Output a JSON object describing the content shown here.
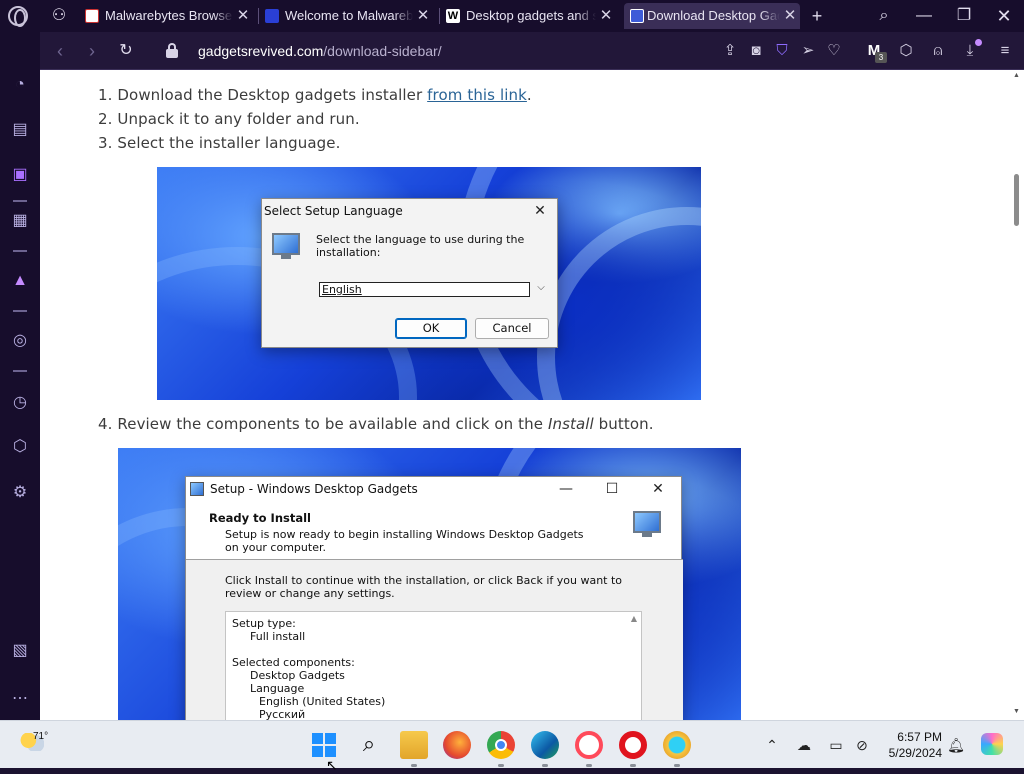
{
  "tabs": [
    {
      "title": "Malwarebytes Browser G",
      "active": false
    },
    {
      "title": "Welcome to Malwareby",
      "active": false
    },
    {
      "title": "Desktop gadgets and si",
      "active": false
    },
    {
      "title": "Download Desktop Gadg",
      "active": true
    }
  ],
  "address": {
    "domain": "gadgetsrevived.com",
    "path": "/download-sidebar/",
    "badge_count": "3"
  },
  "content": {
    "step1_prefix": "Download the Desktop gadgets installer ",
    "step1_link": "from this link",
    "step1_suffix": ".",
    "step2": "Unpack it to any folder and run.",
    "step3": "Select the installer language.",
    "step4_prefix": "Review the components to be available and click on the ",
    "step4_em": "Install",
    "step4_suffix": " button.",
    "n1": "1.",
    "n2": "2.",
    "n3": "3.",
    "n4": "4."
  },
  "lang_dialog": {
    "title": "Select Setup Language",
    "message": "Select the language to use during the installation:",
    "selected": "English",
    "ok": "OK",
    "cancel": "Cancel"
  },
  "setup_dialog": {
    "title": "Setup - Windows Desktop Gadgets",
    "heading": "Ready to Install",
    "subheading": "Setup is now ready to begin installing Windows Desktop Gadgets on your computer.",
    "instruction": "Click Install to continue with the installation, or click Back if you want to review or change any settings.",
    "memo": [
      "Setup type:",
      "Full install",
      "",
      "Selected components:",
      "Desktop Gadgets",
      "Language",
      "English (United States)",
      "Русский"
    ]
  },
  "taskbar": {
    "weather_temp": "71°",
    "time": "6:57 PM",
    "date": "5/29/2024"
  }
}
